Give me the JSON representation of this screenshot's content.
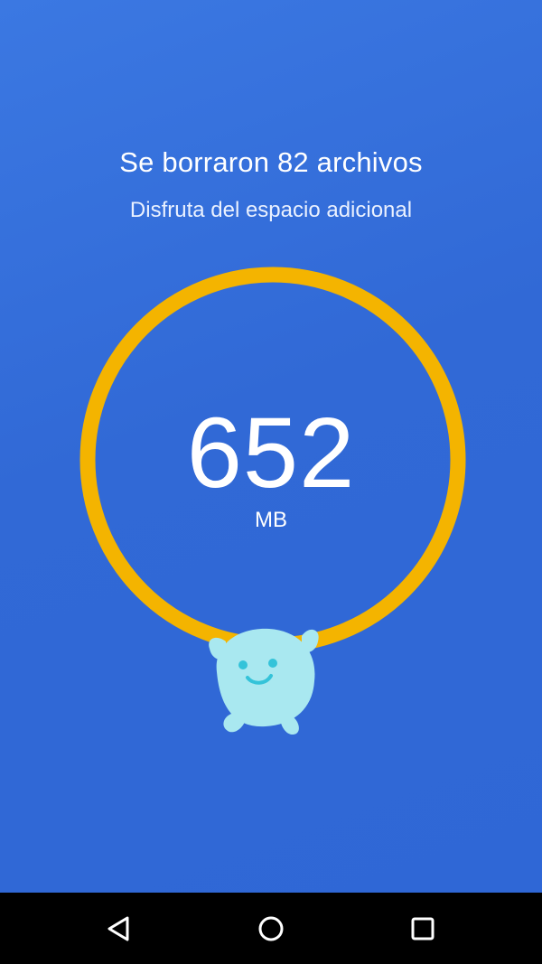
{
  "result": {
    "title": "Se borraron 82 archivos",
    "subtitle": "Disfruta del espacio adicional",
    "value": "652",
    "unit": "MB"
  },
  "colors": {
    "background": "#3169d6",
    "ring": "#f4b400",
    "text": "#ffffff",
    "mascot": "#a9e8f0",
    "mascot_face": "#34c3d9",
    "navbar": "#000000"
  },
  "icons": {
    "mascot": "smiling-mascot-icon",
    "back": "back-triangle-icon",
    "home": "home-circle-icon",
    "recents": "recents-square-icon"
  }
}
